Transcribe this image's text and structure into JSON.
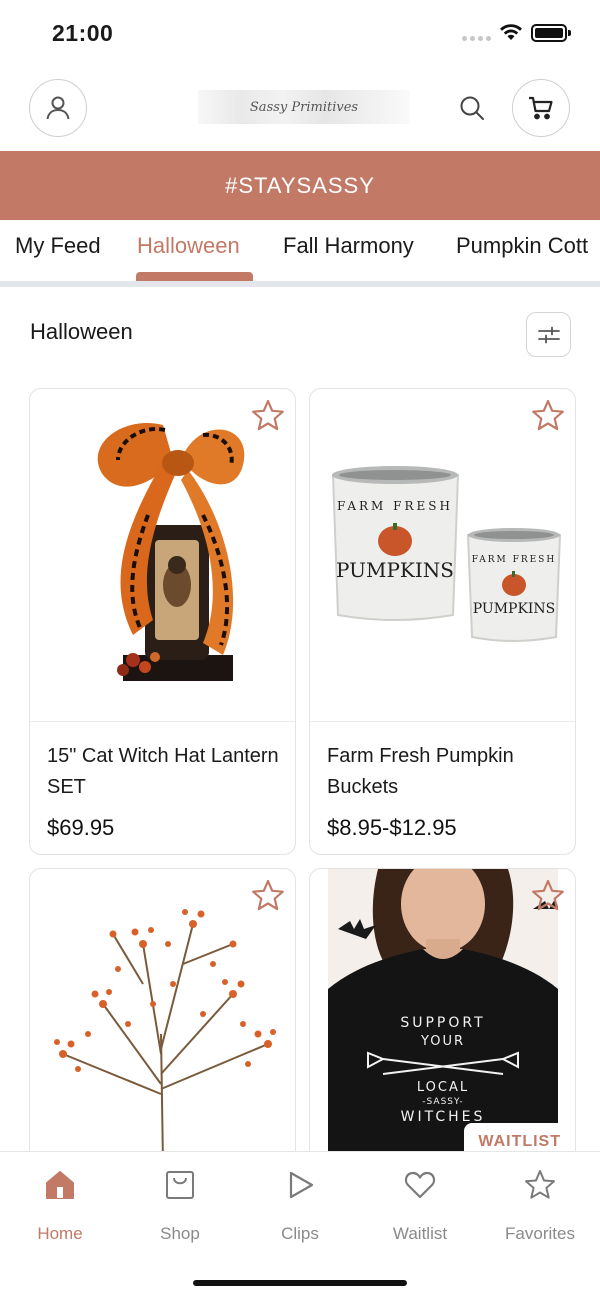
{
  "status_bar": {
    "time": "21:00"
  },
  "header": {
    "logo_text": "Sassy Primitives"
  },
  "banner": {
    "text": "#STAYSASSY"
  },
  "tabs": [
    {
      "label": "My Feed"
    },
    {
      "label": "Halloween",
      "active": true
    },
    {
      "label": "Fall Harmony"
    },
    {
      "label": "Pumpkin Cott"
    }
  ],
  "section": {
    "title": "Halloween"
  },
  "products": [
    {
      "name": "15\" Cat Witch Hat Lantern SET",
      "price": "$69.95",
      "image_icon": "lantern-with-bow-image"
    },
    {
      "name": "Farm Fresh Pumpkin Buckets",
      "price": "$8.95-$12.95",
      "image_icon": "pumpkin-buckets-image",
      "bucket_text_top": "FARM FRESH",
      "bucket_text_main": "PUMPKINS"
    },
    {
      "name": "",
      "price": "",
      "image_icon": "orange-berry-bush-image"
    },
    {
      "name": "",
      "price": "",
      "image_icon": "witches-tshirt-image",
      "badge": "WAITLIST",
      "shirt_text": [
        "SUPPORT",
        "YOUR",
        "LOCAL",
        "-SASSY-",
        "WITCHES"
      ]
    }
  ],
  "bottom_nav": [
    {
      "label": "Home",
      "icon": "home-icon",
      "active": true
    },
    {
      "label": "Shop",
      "icon": "shop-bag-icon"
    },
    {
      "label": "Clips",
      "icon": "play-icon"
    },
    {
      "label": "Waitlist",
      "icon": "heart-icon"
    },
    {
      "label": "Favorites",
      "icon": "star-icon"
    }
  ],
  "colors": {
    "accent": "#c27a67",
    "muted": "#8a8a8a",
    "border": "#e3e3e3"
  }
}
